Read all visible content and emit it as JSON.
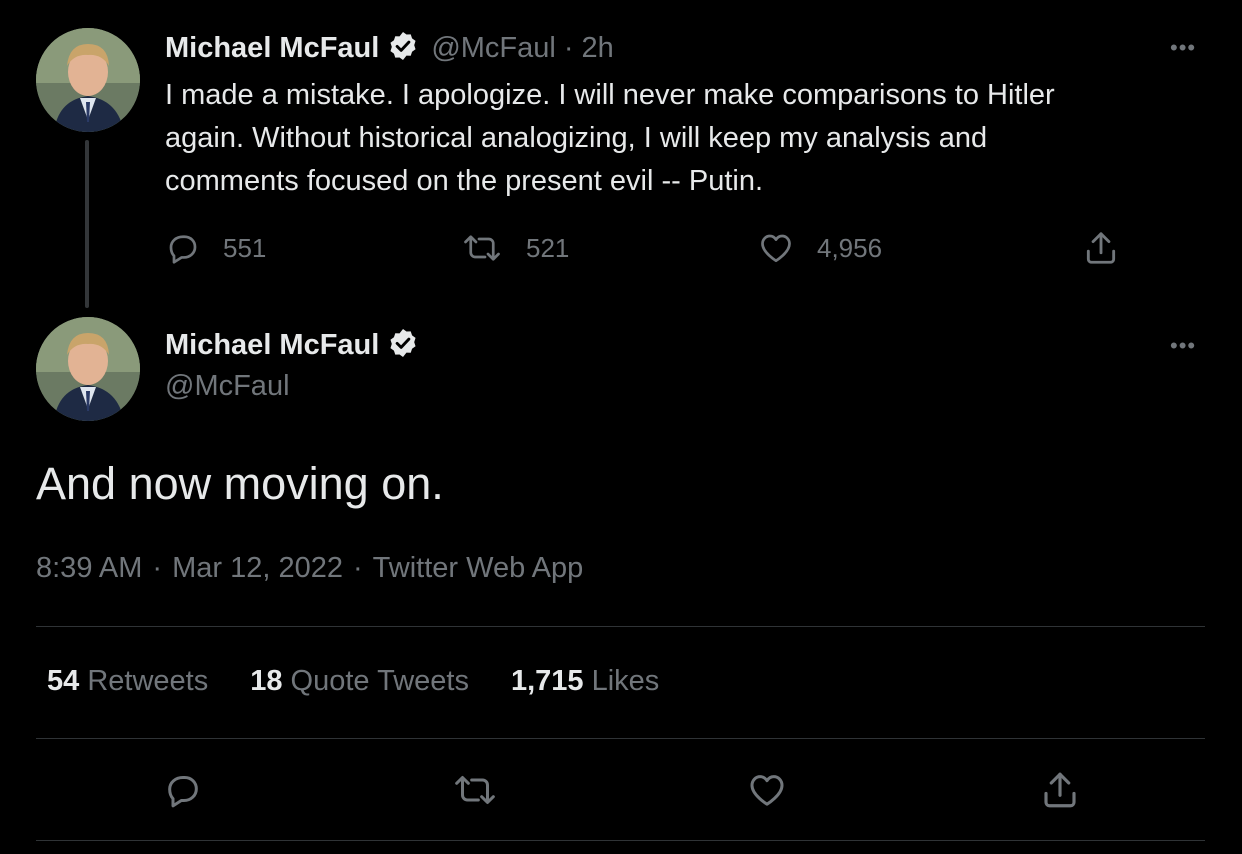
{
  "colors": {
    "background": "#000000",
    "text": "#e7e9ea",
    "muted": "#71767b",
    "divider": "#2f3336"
  },
  "parent_tweet": {
    "display_name": "Michael McFaul",
    "handle": "@McFaul",
    "separator": "·",
    "time_ago": "2h",
    "more_label": "•••",
    "text_lines": [
      "I made a mistake. I apologize. I will never make comparisons to Hitler",
      "again. Without historical analogizing, I will keep my analysis and",
      "comments focused on the present evil -- Putin."
    ],
    "actions": {
      "replies": "551",
      "retweets": "521",
      "likes": "4,956"
    },
    "icons": [
      "reply-icon",
      "retweet-icon",
      "like-icon",
      "share-icon"
    ]
  },
  "main_tweet": {
    "display_name": "Michael McFaul",
    "handle": "@McFaul",
    "more_label": "•••",
    "text": "And now moving on.",
    "time": "8:39 AM",
    "date": "Mar 12, 2022",
    "source": "Twitter Web App",
    "dot": "·",
    "stats": {
      "retweets_count": "54",
      "retweets_label": "Retweets",
      "quotes_count": "18",
      "quotes_label": "Quote Tweets",
      "likes_count": "1,715",
      "likes_label": "Likes"
    },
    "icons": [
      "reply-icon",
      "retweet-icon",
      "like-icon",
      "share-icon"
    ]
  }
}
